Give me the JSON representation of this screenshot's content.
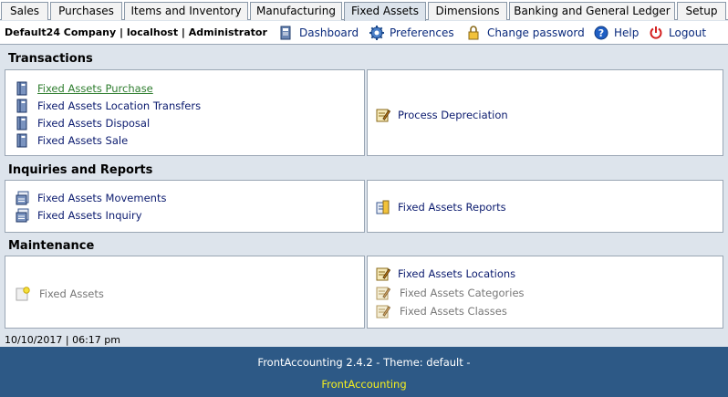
{
  "tabs": [
    "Sales",
    "Purchases",
    "Items and Inventory",
    "Manufacturing",
    "Fixed Assets",
    "Dimensions",
    "Banking and General Ledger",
    "Setup"
  ],
  "active_tab": "Fixed Assets",
  "header": {
    "company": "Default24 Company | localhost | Administrator",
    "dashboard": "Dashboard",
    "preferences": "Preferences",
    "change_password": "Change password",
    "help": "Help",
    "logout": "Logout"
  },
  "transactions": {
    "title": "Transactions",
    "purchase": "Fixed Assets Purchase",
    "location_transfers": "Fixed Assets Location Transfers",
    "disposal": "Fixed Assets Disposal",
    "sale": "Fixed Assets Sale",
    "process_depreciation": "Process Depreciation"
  },
  "inquiries": {
    "title": "Inquiries and Reports",
    "movements": "Fixed Assets Movements",
    "inquiry": "Fixed Assets Inquiry",
    "reports": "Fixed Assets Reports"
  },
  "maintenance": {
    "title": "Maintenance",
    "fixed_assets": "Fixed Assets",
    "locations": "Fixed Assets Locations",
    "categories": "Fixed Assets Categories",
    "classes": "Fixed Assets Classes"
  },
  "status": "10/10/2017 | 06:17 pm",
  "footer": {
    "version": "FrontAccounting 2.4.2 - Theme: default -",
    "brand": "FrontAccounting"
  },
  "colors": {
    "link": "#0a1a6e",
    "visited_link": "#2e7d2e",
    "disabled": "#777777",
    "footer_bg": "#2d5986",
    "footer_brand": "#f5ef1e",
    "page_bg": "#dde4ec"
  }
}
